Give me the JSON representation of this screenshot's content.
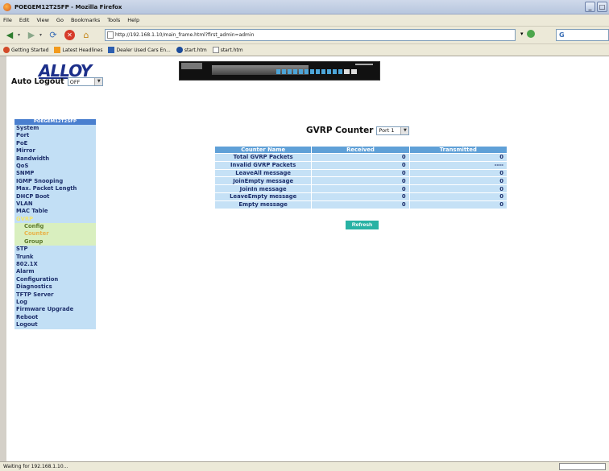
{
  "window": {
    "title": "POEGEM12T2SFP - Mozilla Firefox"
  },
  "menu": [
    "File",
    "Edit",
    "View",
    "Go",
    "Bookmarks",
    "Tools",
    "Help"
  ],
  "address": {
    "url": "http://192.168.1.10/main_frame.html?first_admin=admin",
    "search_value": "G"
  },
  "bookmarks": [
    "Getting Started",
    "Latest Headlines",
    "Dealer Used Cars En...",
    "start.htm",
    "start.htm"
  ],
  "header": {
    "logo": "ALLOY",
    "autologout_label": "Auto Logout",
    "autologout_value": "OFF"
  },
  "sidebar": {
    "title": "POEGEM12T2SFP",
    "items": [
      "System",
      "Port",
      "PoE",
      "Mirror",
      "Bandwidth",
      "QoS",
      "SNMP",
      "IGMP Snooping",
      "Max. Packet Length",
      "DHCP Boot",
      "VLAN",
      "MAC Table",
      "GVRP"
    ],
    "sub_items": [
      "Config",
      "Counter",
      "Group"
    ],
    "items_after": [
      "STP",
      "Trunk",
      "802.1X",
      "Alarm",
      "Configuration",
      "Diagnostics",
      "TFTP Server",
      "Log",
      "Firmware Upgrade",
      "Reboot",
      "Logout"
    ],
    "active_item": "GVRP",
    "active_sub": "Counter"
  },
  "main": {
    "title": "GVRP Counter",
    "port_value": "Port 1",
    "table": {
      "headers": [
        "Counter Name",
        "Received",
        "Transmitted"
      ],
      "rows": [
        [
          "Total GVRP Packets",
          "0",
          "0"
        ],
        [
          "Invalid GVRP Packets",
          "0",
          "----"
        ],
        [
          "LeaveAll message",
          "0",
          "0"
        ],
        [
          "JoinEmpty message",
          "0",
          "0"
        ],
        [
          "JoinIn message",
          "0",
          "0"
        ],
        [
          "LeaveEmpty message",
          "0",
          "0"
        ],
        [
          "Empty message",
          "0",
          "0"
        ]
      ]
    },
    "refresh_label": "Refresh"
  },
  "status": {
    "text": "Waiting for 192.168.1.10..."
  },
  "colors": {
    "sidebar_bg": "#c2dff5",
    "table_header": "#5fa0d7",
    "refresh_button": "#28b2a4",
    "logo": "#1c2f8a"
  }
}
